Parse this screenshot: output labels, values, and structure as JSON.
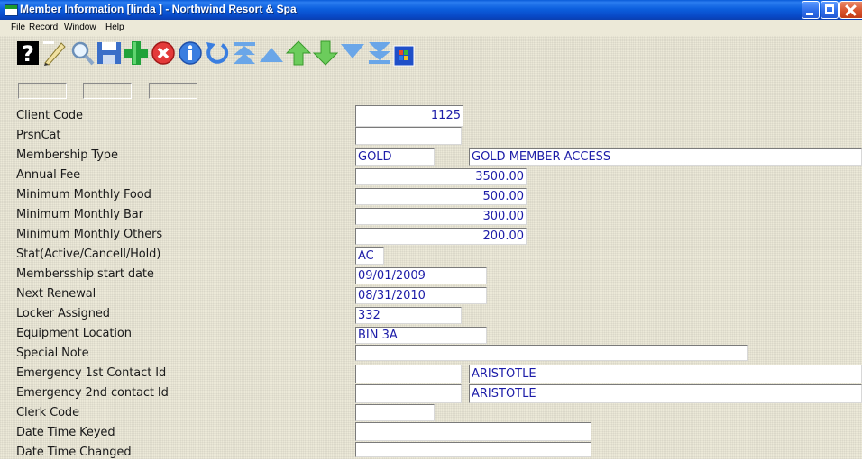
{
  "window": {
    "title": "Member Information [linda  ] - Northwind Resort & Spa"
  },
  "menu": [
    "File",
    "Record",
    "Window",
    "Help"
  ],
  "toolbar": {
    "icons": [
      "help-icon",
      "new-record-icon",
      "search-icon",
      "save-icon",
      "add-icon",
      "delete-icon",
      "info-icon",
      "undo-icon",
      "first-record-icon",
      "previous-page-icon",
      "previous-record-icon",
      "next-record-icon",
      "next-page-icon",
      "last-record-icon",
      "windows-icon"
    ]
  },
  "form": {
    "client_code": {
      "label": "Client Code",
      "value": "1125"
    },
    "prsn_cat": {
      "label": "PrsnCat",
      "value": ""
    },
    "membership_type": {
      "label": "Membership Type",
      "code": "GOLD",
      "description": "GOLD MEMBER ACCESS"
    },
    "annual_fee": {
      "label": "Annual Fee",
      "value": "3500.00"
    },
    "min_monthly_food": {
      "label": "Minimum Monthly Food",
      "value": "500.00"
    },
    "min_monthly_bar": {
      "label": "Minimum Monthly Bar",
      "value": "300.00"
    },
    "min_monthly_others": {
      "label": "Minimum Monthly Others",
      "value": "200.00"
    },
    "status": {
      "label": "Stat(Active/Cancell/Hold)",
      "value": "AC"
    },
    "membership_start": {
      "label": "Membersship start date",
      "value": "09/01/2009"
    },
    "next_renewal": {
      "label": "Next Renewal",
      "value": "08/31/2010"
    },
    "locker_assigned": {
      "label": "Locker Assigned",
      "value": "332"
    },
    "equipment_location": {
      "label": "Equipment Location",
      "value": "BIN 3A"
    },
    "special_note": {
      "label": "Special Note",
      "value": ""
    },
    "emergency_1": {
      "label": "Emergency 1st Contact Id",
      "id": "",
      "name": "ARISTOTLE"
    },
    "emergency_2": {
      "label": "Emergency 2nd contact Id",
      "id": "",
      "name": "ARISTOTLE"
    },
    "clerk_code": {
      "label": "Clerk Code",
      "value": ""
    },
    "date_time_keyed": {
      "label": "Date Time Keyed",
      "value": ""
    },
    "date_time_changed": {
      "label": "Date Time Changed",
      "value": ""
    }
  },
  "colors": {
    "title_bar": "#0c5fde",
    "field_text": "#1c1ca8",
    "background": "#ece9d8"
  }
}
